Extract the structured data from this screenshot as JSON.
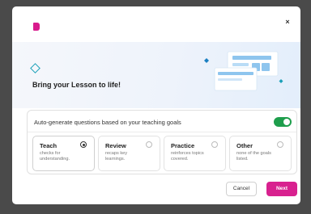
{
  "header": {
    "close_label": "×"
  },
  "hero": {
    "title": "Bring your Lesson to life!"
  },
  "settings": {
    "label": "Auto-generate questions based on your teaching goals",
    "toggle_on": true,
    "options": [
      {
        "title": "Teach",
        "description": "checks for understanding.",
        "selected": true
      },
      {
        "title": "Review",
        "description": "recaps key learnings.",
        "selected": false
      },
      {
        "title": "Practice",
        "description": "reinforces topics covered.",
        "selected": false
      },
      {
        "title": "Other",
        "description": "none of the goals listed.",
        "selected": false
      }
    ]
  },
  "footer": {
    "cancel_label": "Cancel",
    "next_label": "Next"
  },
  "colors": {
    "brand": "#d8218f",
    "toggle": "#1e9e4c",
    "accent": "#1aa0b8",
    "illustration_blue": "#8ec5ee"
  }
}
